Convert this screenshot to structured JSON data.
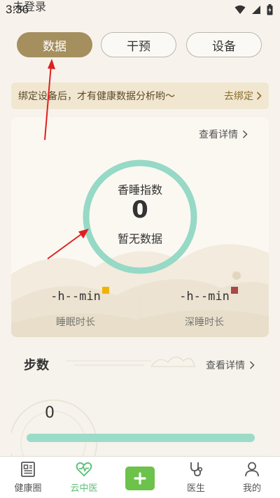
{
  "status": {
    "time": "3:36",
    "overlay_text": "未登录",
    "icons": [
      "wifi-icon",
      "signal-icon",
      "battery-charging-icon"
    ]
  },
  "segments": [
    {
      "label": "数据",
      "active": true
    },
    {
      "label": "干预",
      "active": false
    },
    {
      "label": "设备",
      "active": false
    }
  ],
  "banner": {
    "text": "绑定设备后，才有健康数据分析哟～",
    "link": "去绑定"
  },
  "sleep_card": {
    "detail_link": "查看详情",
    "ring_title": "香睡指数",
    "ring_value": "0",
    "ring_sub": "暂无数据",
    "ring_color": "#96d9c6",
    "metrics": [
      {
        "value": "-h--min",
        "label": "睡眠时长",
        "dot_color": "#f0b400"
      },
      {
        "value": "-h--min",
        "label": "深睡时长",
        "dot_color": "#a84848"
      }
    ]
  },
  "steps_card": {
    "title": "步数",
    "detail_link": "查看详情",
    "value": "0",
    "bar_color": "#9bdcc9"
  },
  "tabbar": {
    "items": [
      {
        "label": "健康圈",
        "icon": "news-icon",
        "active": false
      },
      {
        "label": "云中医",
        "icon": "heart-pulse-icon",
        "active": true
      },
      {
        "label": "",
        "icon": "plus-icon",
        "active": false
      },
      {
        "label": "医生",
        "icon": "stethoscope-icon",
        "active": false
      },
      {
        "label": "我的",
        "icon": "user-icon",
        "active": false
      }
    ],
    "add_color": "#6cc24a"
  },
  "annotations": {
    "arrow_color": "#e02020"
  }
}
